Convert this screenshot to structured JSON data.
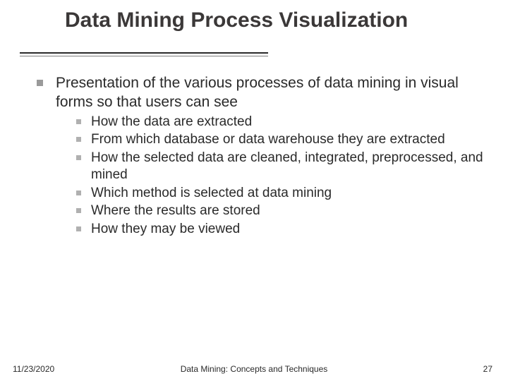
{
  "slide": {
    "title": "Data Mining Process Visualization",
    "main": "Presentation of the various processes of data mining in visual forms so that users can see",
    "subpoints": [
      "How the data are extracted",
      "From which database or data warehouse they are extracted",
      "How the selected data are cleaned, integrated, preprocessed, and mined",
      "Which method is selected at data mining",
      "Where the results are stored",
      "How they may be viewed"
    ]
  },
  "footer": {
    "date": "11/23/2020",
    "center": "Data Mining: Concepts and Techniques",
    "page": "27"
  }
}
